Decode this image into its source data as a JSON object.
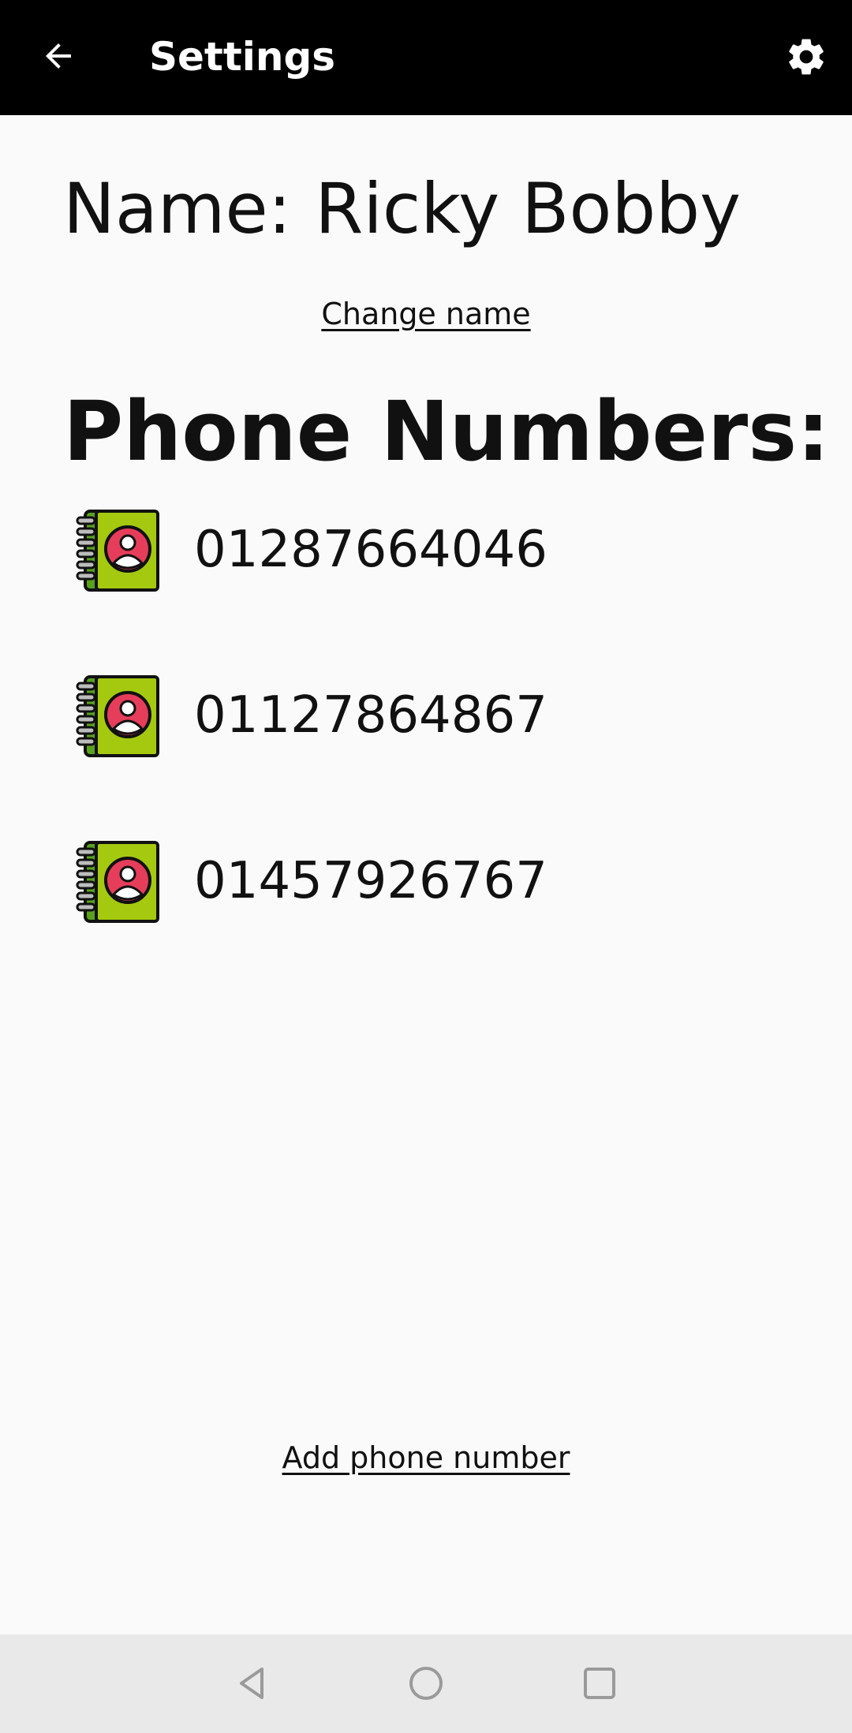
{
  "appbar": {
    "title": "Settings",
    "back_icon": "arrow-left-icon",
    "settings_icon": "gear-icon",
    "background": "#000000"
  },
  "profile": {
    "name_label": "Name:",
    "name_value": "Ricky Bobby",
    "change_name_link": "Change name"
  },
  "phones": {
    "title": "Phone Numbers:",
    "icon": "address-book-icon",
    "icon_colors": {
      "cover": "#a4c90f",
      "spine": "#5aa21e",
      "avatar_bg": "#e63d5a"
    },
    "items": [
      {
        "number": "01287664046"
      },
      {
        "number": "01127864867"
      },
      {
        "number": "01457926767"
      }
    ],
    "add_link": "Add phone number"
  },
  "navbar": {
    "back_icon": "nav-back-triangle-icon",
    "home_icon": "nav-home-circle-icon",
    "recents_icon": "nav-recents-square-icon"
  }
}
